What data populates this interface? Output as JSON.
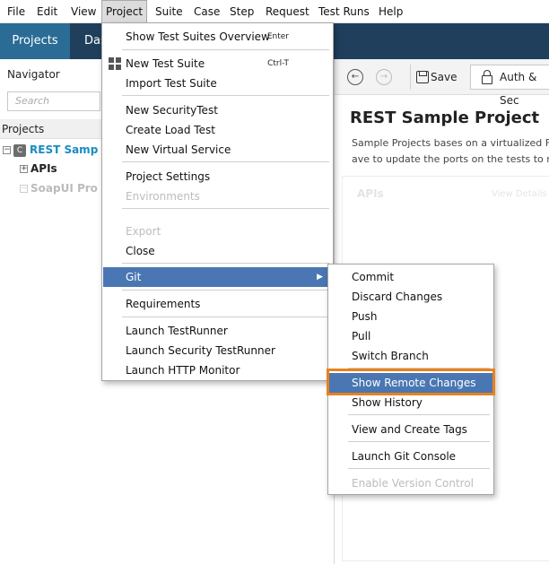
{
  "menubar": {
    "items": [
      "File",
      "Edit",
      "View",
      "Project",
      "Suite",
      "Case",
      "Step",
      "Request",
      "Test Runs",
      "Help"
    ],
    "active": "Project"
  },
  "topbar": {
    "tabs": [
      "Projects",
      "Das"
    ]
  },
  "navigator": {
    "title": "Navigator",
    "search_placeholder": "Search",
    "header": "Projects",
    "tree": {
      "project_badge": "C",
      "project": "REST Samp",
      "apis": "APIs",
      "soapui": "SoapUI Pro"
    }
  },
  "right_panel": {
    "save_label": "Save",
    "auth_label": "Auth & Sec",
    "title": "REST Sample Project",
    "desc_line1": "Sample Projects bases on a virtualized F",
    "desc_line2": "ave to update the ports on the tests to re",
    "card_label": "APIs",
    "card_link": "View Details"
  },
  "project_menu": {
    "items": [
      {
        "label": "Show Test Suites Overview",
        "accel": "Enter",
        "enabled": true
      },
      {
        "label": "New Test Suite",
        "accel": "Ctrl-T",
        "enabled": true,
        "icon": "grid-icon"
      },
      {
        "label": "Import Test Suite",
        "enabled": true
      },
      {
        "label": "New SecurityTest",
        "enabled": true
      },
      {
        "label": "Create Load Test",
        "enabled": true
      },
      {
        "label": "New Virtual Service",
        "enabled": true
      },
      {
        "label": "Project Settings",
        "enabled": true
      },
      {
        "label": "Environments",
        "enabled": false
      },
      {
        "label": "Export",
        "enabled": false
      },
      {
        "label": "Close",
        "enabled": true
      },
      {
        "label": "Git",
        "enabled": true,
        "submenu": true,
        "highlighted": true
      },
      {
        "label": "Requirements",
        "enabled": true
      },
      {
        "label": "Launch TestRunner",
        "enabled": true
      },
      {
        "label": "Launch Security TestRunner",
        "enabled": true
      },
      {
        "label": "Launch HTTP Monitor",
        "enabled": true
      }
    ]
  },
  "git_menu": {
    "items": [
      {
        "label": "Commit",
        "enabled": true
      },
      {
        "label": "Discard Changes",
        "enabled": true
      },
      {
        "label": "Push",
        "enabled": true
      },
      {
        "label": "Pull",
        "enabled": true
      },
      {
        "label": "Switch Branch",
        "enabled": true
      },
      {
        "label": "Show Remote Changes",
        "enabled": true,
        "highlighted": true
      },
      {
        "label": "Show History",
        "enabled": true
      },
      {
        "label": "View and Create Tags",
        "enabled": true
      },
      {
        "label": "Launch Git Console",
        "enabled": true
      },
      {
        "label": "Enable Version Control",
        "enabled": false
      }
    ]
  },
  "colors": {
    "topbar": "#1f3f5c",
    "active_tab": "#2a6c95",
    "menu_highlight": "#4a77b3",
    "callout_outline": "#e8821c",
    "tree_project": "#1a8bc2"
  }
}
